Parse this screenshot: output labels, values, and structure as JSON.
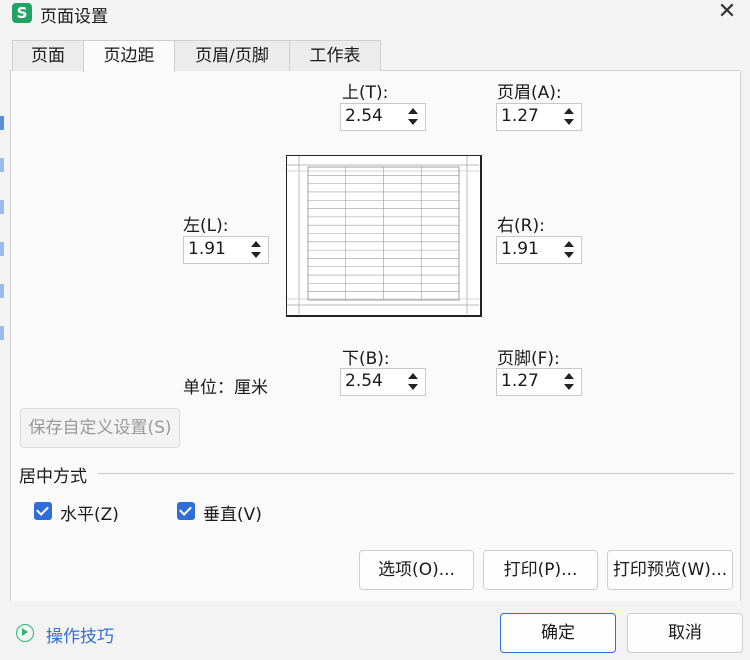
{
  "window": {
    "title": "页面设置",
    "app_icon": "S"
  },
  "tabs": [
    {
      "label": "页面"
    },
    {
      "label": "页边距"
    },
    {
      "label": "页眉/页脚"
    },
    {
      "label": "工作表"
    }
  ],
  "active_tab": "页边距",
  "margins": {
    "top": {
      "label": "上(T):",
      "value": "2.54"
    },
    "header": {
      "label": "页眉(A):",
      "value": "1.27"
    },
    "left": {
      "label": "左(L):",
      "value": "1.91"
    },
    "right": {
      "label": "右(R):",
      "value": "1.91"
    },
    "bottom": {
      "label": "下(B):",
      "value": "2.54"
    },
    "footer": {
      "label": "页脚(F):",
      "value": "1.27"
    }
  },
  "unit_label": "单位：厘米",
  "save_custom_label": "保存自定义设置(S)",
  "center": {
    "group_label": "居中方式",
    "horizontal": {
      "label": "水平(Z)",
      "checked": true
    },
    "vertical": {
      "label": "垂直(V)",
      "checked": true
    }
  },
  "buttons": {
    "options": "选项(O)...",
    "print": "打印(P)...",
    "print_preview": "打印预览(W)...",
    "ok": "确定",
    "cancel": "取消"
  },
  "tips_label": "操作技巧",
  "colors": {
    "accent": "#2f6fd6",
    "app_icon": "#21a366",
    "checkbox": "#2f6ed8"
  }
}
